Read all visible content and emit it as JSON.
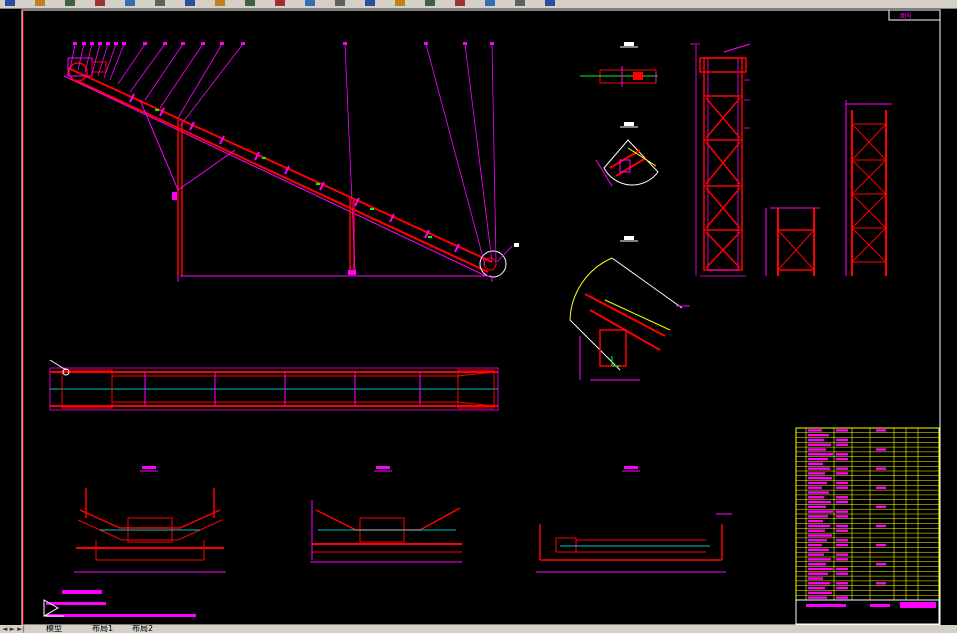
{
  "toolbar": {
    "icons": [
      "open-icon",
      "save-icon",
      "print-icon",
      "undo-icon",
      "redo-icon",
      "pan-icon",
      "zoom-realtime-icon",
      "zoom-window-icon",
      "zoom-previous-icon",
      "properties-icon",
      "design-center-icon",
      "tool-palettes-icon",
      "sheet-set-icon",
      "markup-icon",
      "calculator-icon",
      "help-icon",
      "layer-icon",
      "match-icon",
      "extra-icon"
    ]
  },
  "layout_tabs": {
    "nav": "◄ ► ►|",
    "tabs": [
      "模型",
      "布局1",
      "布局2"
    ]
  },
  "drawing": {
    "colors": {
      "red": "#ff0000",
      "magenta": "#ff00ff",
      "cyan": "#00ffff",
      "green": "#00ff00",
      "white": "#ffffff",
      "yellow": "#ffff00"
    }
  }
}
